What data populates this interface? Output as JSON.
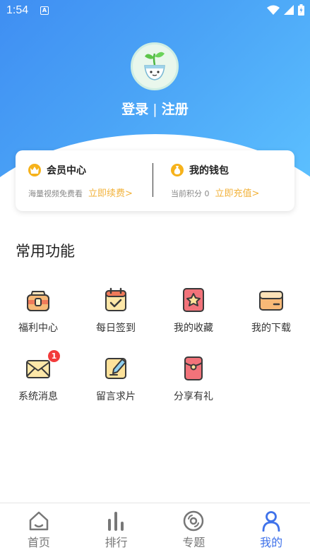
{
  "status_bar": {
    "time": "1:54",
    "notification_glyph": "A"
  },
  "profile": {
    "login": "登录",
    "separator": "|",
    "register": "注册"
  },
  "card": {
    "member": {
      "title": "会员中心",
      "note": "海量视频免费看",
      "action": "立即续费>"
    },
    "wallet": {
      "title": "我的钱包",
      "note_label": "当前积分",
      "points": "0",
      "action": "立即充值>"
    }
  },
  "section_title": "常用功能",
  "features": [
    {
      "label": "福利中心",
      "icon": "gift-box-icon"
    },
    {
      "label": "每日签到",
      "icon": "calendar-check-icon"
    },
    {
      "label": "我的收藏",
      "icon": "star-icon"
    },
    {
      "label": "我的下载",
      "icon": "folder-icon"
    },
    {
      "label": "系统消息",
      "icon": "envelope-icon",
      "badge": "1"
    },
    {
      "label": "留言求片",
      "icon": "edit-note-icon"
    },
    {
      "label": "分享有礼",
      "icon": "red-envelope-icon"
    }
  ],
  "nav": [
    {
      "label": "首页",
      "icon": "home-icon"
    },
    {
      "label": "排行",
      "icon": "bar-chart-icon"
    },
    {
      "label": "专题",
      "icon": "disc-icon"
    },
    {
      "label": "我的",
      "icon": "user-icon",
      "active": true
    }
  ],
  "colors": {
    "primary": "#3f72ea",
    "accent_gold": "#f2b23a",
    "badge_red": "#f23b3b"
  }
}
